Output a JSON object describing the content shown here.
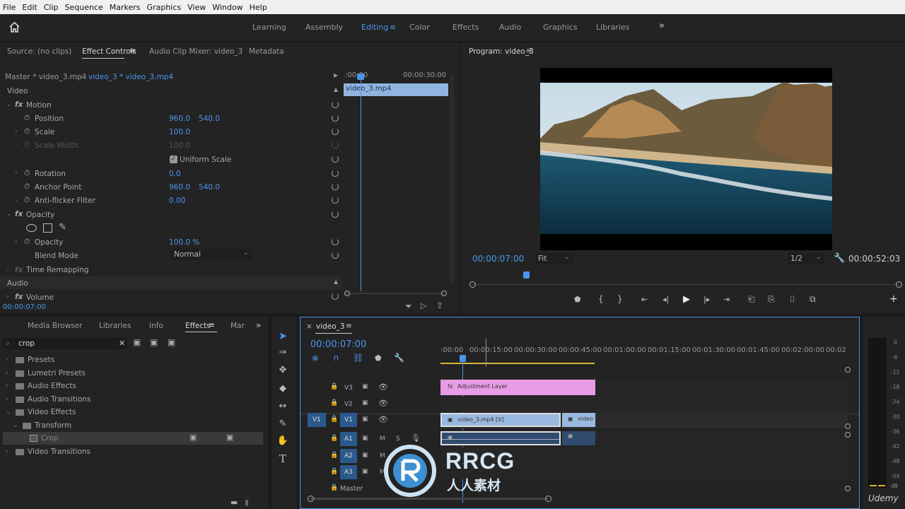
{
  "menu": [
    "File",
    "Edit",
    "Clip",
    "Sequence",
    "Markers",
    "Graphics",
    "View",
    "Window",
    "Help"
  ],
  "workspaces": {
    "items": [
      "Learning",
      "Assembly",
      "Editing",
      "Color",
      "Effects",
      "Audio",
      "Graphics",
      "Libraries"
    ],
    "active": "Editing",
    "more": "»"
  },
  "source_panel": {
    "tabs": [
      "Source: (no clips)",
      "Effect Controls",
      "Audio Clip Mixer: video_3",
      "Metadata"
    ],
    "master": "Master * video_3.mp4",
    "clip": "video_3 * video_3.mp4",
    "ruler_start": ":00:00",
    "ruler_end": "00:00:30:00",
    "clip_bar": "video_3.mp4",
    "sections": {
      "video": "Video",
      "audio": "Audio"
    },
    "rows": {
      "motion": "Motion",
      "position": "Position",
      "position_x": "960.0",
      "position_y": "540.0",
      "scale": "Scale",
      "scale_val": "100.0",
      "scale_width": "Scale Width",
      "scale_width_val": "100.0",
      "uniform_scale": "Uniform Scale",
      "rotation": "Rotation",
      "rotation_val": "0.0",
      "anchor": "Anchor Point",
      "anchor_x": "960.0",
      "anchor_y": "540.0",
      "antiflicker": "Anti-flicker Filter",
      "antiflicker_val": "0.00",
      "opacity_section": "Opacity",
      "opacity": "Opacity",
      "opacity_val": "100.0 %",
      "blend_mode": "Blend Mode",
      "blend_val": "Normal",
      "time_remap": "Time Remapping",
      "volume": "Volume"
    },
    "timecode": "00:00:07:00"
  },
  "program_monitor": {
    "title": "Program: video_3",
    "timecode": "00:00:07:00",
    "fit": "Fit",
    "resolution": "1/2",
    "duration": "00:00:52:03"
  },
  "project_panel": {
    "tabs": [
      "Media Browser",
      "Libraries",
      "Info",
      "Effects",
      "Mar"
    ],
    "active_tab": "Effects",
    "search_value": "crop",
    "tree": [
      "Presets",
      "Lumetri Presets",
      "Audio Effects",
      "Audio Transitions",
      "Video Effects",
      "Transform",
      "Crop",
      "Video Transitions"
    ]
  },
  "timeline": {
    "sequence": "video_3",
    "timecode": "00:00:07:00",
    "ruler": [
      ":00:00",
      "00:00:15:00",
      "00:00:30:00",
      "00:00:45:00",
      "00:01:00:00",
      "00:01:15:00",
      "00:01:30:00",
      "00:01:45:00",
      "00:02:00:00",
      "00:02"
    ],
    "tracks": {
      "v3": "V3",
      "v2": "V2",
      "v1": "V1",
      "v1_src": "V1",
      "a1": "A1",
      "a2": "A2",
      "a3": "A3",
      "master": "Master",
      "m": "M",
      "s": "S"
    },
    "clips": {
      "adjustment": "Adjustment Layer",
      "video_v": "video_3.mp4 [V]",
      "video_short": "video"
    }
  },
  "meter": {
    "labels": [
      "0",
      "-6",
      "-12",
      "-18",
      "-24",
      "-30",
      "-36",
      "-42",
      "-48",
      "-54"
    ],
    "bottom": "dB"
  },
  "watermark": {
    "brand": "RRCG",
    "sub": "人人素材",
    "udemy": "Udemy"
  }
}
